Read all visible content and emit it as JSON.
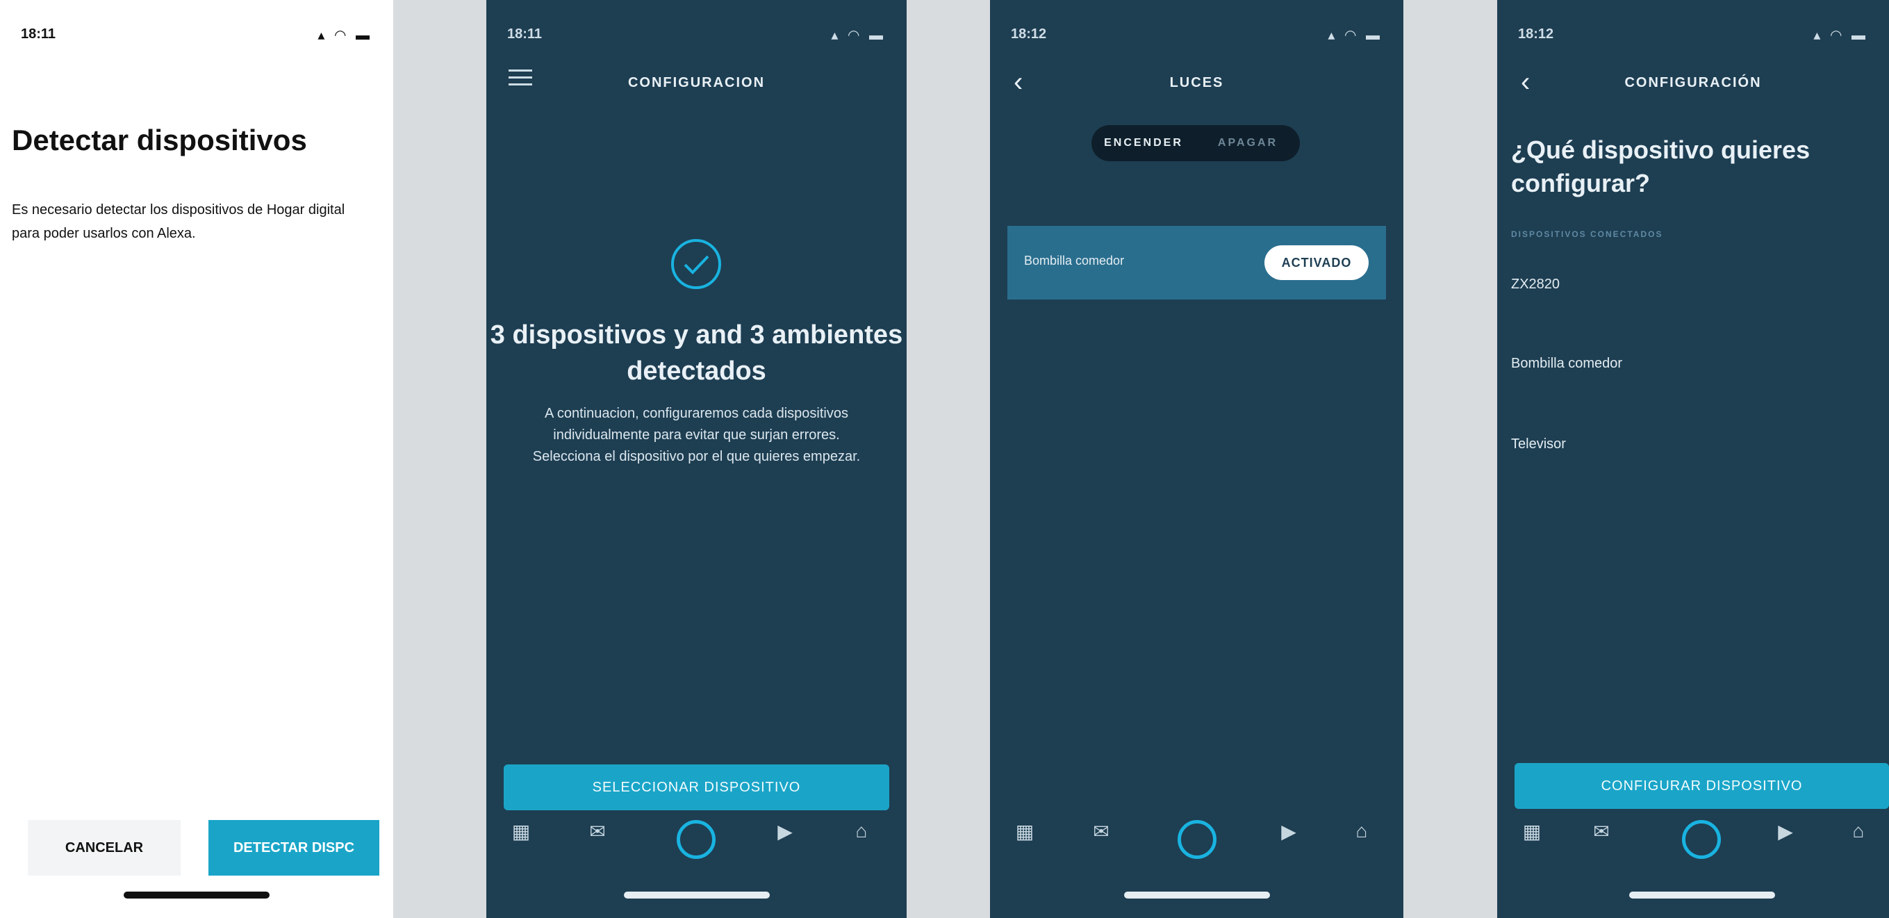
{
  "screen1": {
    "time": "18:11",
    "title": "Detectar dispositivos",
    "description": "Es necesario detectar los dispositivos de Hogar digital para poder usarlos con Alexa.",
    "cancel_label": "CANCELAR",
    "detect_label": "DETECTAR DISPC"
  },
  "screen2": {
    "time": "18:11",
    "header": "CONFIGURACION",
    "heading": "3 dispositivos y and 3 ambientes detectados",
    "body": "A continuacion, configuraremos cada dispositivos individualmente para evitar que surjan errores. Selecciona el dispositivo por el que quieres empezar.",
    "button_label": "SELECCIONAR DISPOSITIVO"
  },
  "screen3": {
    "time": "18:12",
    "header": "LUCES",
    "segments": [
      "ENCENDER",
      "APAGAR"
    ],
    "device_name": "Bombilla comedor",
    "toggle_label": "ACTIVADO"
  },
  "screen4": {
    "time": "18:12",
    "header": "CONFIGURACIÓN",
    "question": "¿Qué dispositivo quieres configurar?",
    "section_label": "DISPOSITIVOS CONECTADOS",
    "devices": [
      "ZX2820",
      "Bombilla comedor",
      "Televisor"
    ],
    "button_label": "CONFIGURAR DISPOSITIVO"
  },
  "status_icons": "▴ ◠ ▬",
  "colors": {
    "accent": "#1aa5c8",
    "dark_bg": "#1e3e52",
    "alexa_ring": "#19b3e0"
  }
}
